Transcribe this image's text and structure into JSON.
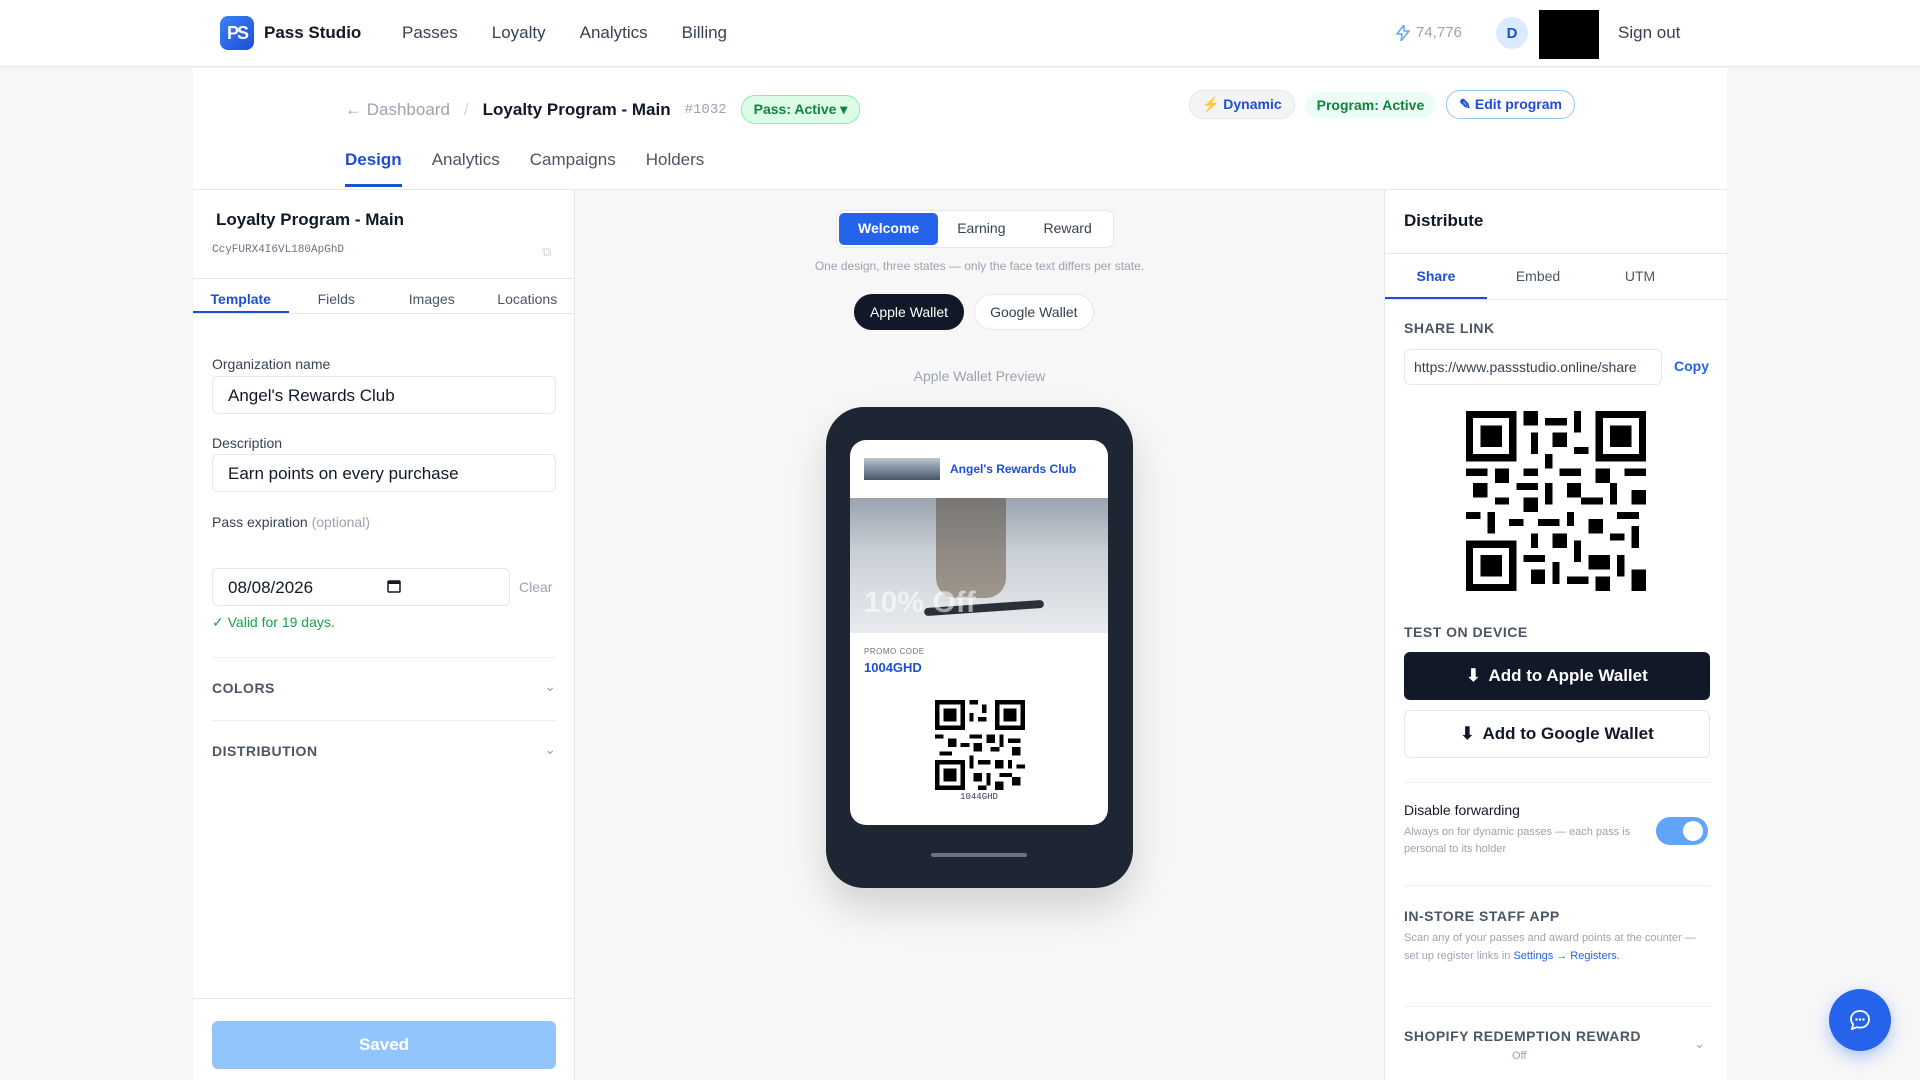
{
  "nav": {
    "logo_text": "PS",
    "brand": "Pass Studio",
    "links": [
      "Passes",
      "Loyalty",
      "Analytics",
      "Billing"
    ],
    "credits": "74,776",
    "avatar_initial": "D",
    "sign_out": "Sign out"
  },
  "header": {
    "back_label": "Dashboard",
    "separator": "/",
    "program_title": "Loyalty Program - Main",
    "program_id": "#1032",
    "pass_status": "Pass: Active",
    "dynamic_label": "Dynamic",
    "program_status": "Program: Active",
    "edit_label": "Edit program",
    "tabs": [
      "Design",
      "Analytics",
      "Campaigns",
      "Holders"
    ]
  },
  "editor": {
    "name": "Loyalty Program - Main",
    "code": "CcyFURX4I6VL180ApGhD",
    "tabs": [
      "Template",
      "Fields",
      "Images",
      "Locations"
    ],
    "org_label": "Organization name",
    "org_value": "Angel's Rewards Club",
    "desc_label": "Description",
    "desc_value": "Earn points on every purchase",
    "exp_label": "Pass expiration",
    "exp_optional": "(optional)",
    "exp_value": "08/08/2026",
    "clear_label": "Clear",
    "valid_note": "✓ Valid for 19 days.",
    "colors_section": "COLORS",
    "distribution_section": "DISTRIBUTION",
    "save_label": "Saved"
  },
  "preview": {
    "states": [
      "Welcome",
      "Earning",
      "Reward"
    ],
    "state_note": "One design, three states — only the face text differs per state.",
    "wallets": [
      "Apple Wallet",
      "Google Wallet"
    ],
    "preview_label": "Apple Wallet Preview",
    "pass_org": "Angel's Rewards Club",
    "offer_text": "10% Off",
    "promo_label": "PROMO CODE",
    "promo_code": "1004GHD",
    "qr_caption": "1044GHD"
  },
  "distribute": {
    "title": "Distribute",
    "tabs": [
      "Share",
      "Embed",
      "UTM"
    ],
    "share_link_label": "SHARE LINK",
    "share_url": "https://www.passstudio.online/share",
    "copy_label": "Copy",
    "test_label": "TEST ON DEVICE",
    "apple_btn": "Add to Apple Wallet",
    "google_btn": "Add to Google Wallet",
    "forwarding_title": "Disable forwarding",
    "forwarding_desc": "Always on for dynamic passes — each pass is personal to its holder",
    "forwarding_on": true,
    "staff_title": "IN-STORE STAFF APP",
    "staff_desc": "Scan any of your passes and award points at the counter — set up register links in",
    "staff_link": "Settings → Registers.",
    "shopify_title": "SHOPIFY REDEMPTION REWARD",
    "shopify_state": "Off"
  },
  "colors": {
    "accent": "#2563eb",
    "active_green": "#15803d",
    "dark": "#111827"
  }
}
